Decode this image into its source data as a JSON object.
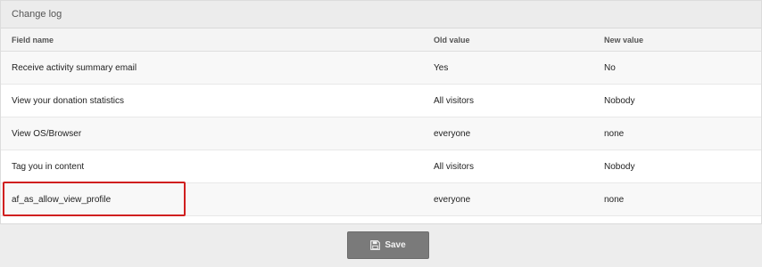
{
  "panel": {
    "title": "Change log"
  },
  "table": {
    "headers": {
      "field": "Field name",
      "old": "Old value",
      "new": "New value"
    },
    "rows": [
      {
        "field": "Receive activity summary email",
        "old": "Yes",
        "new": "No"
      },
      {
        "field": "View your donation statistics",
        "old": "All visitors",
        "new": "Nobody"
      },
      {
        "field": "View OS/Browser",
        "old": "everyone",
        "new": "none"
      },
      {
        "field": "Tag you in content",
        "old": "All visitors",
        "new": "Nobody"
      },
      {
        "field": "af_as_allow_view_profile",
        "old": "everyone",
        "new": "none"
      }
    ]
  },
  "footer": {
    "save_label": "Save",
    "save_icon": "floppy-disk-icon"
  },
  "colors": {
    "highlight": "#d01f1f",
    "button_bg": "#7a7a7a"
  }
}
